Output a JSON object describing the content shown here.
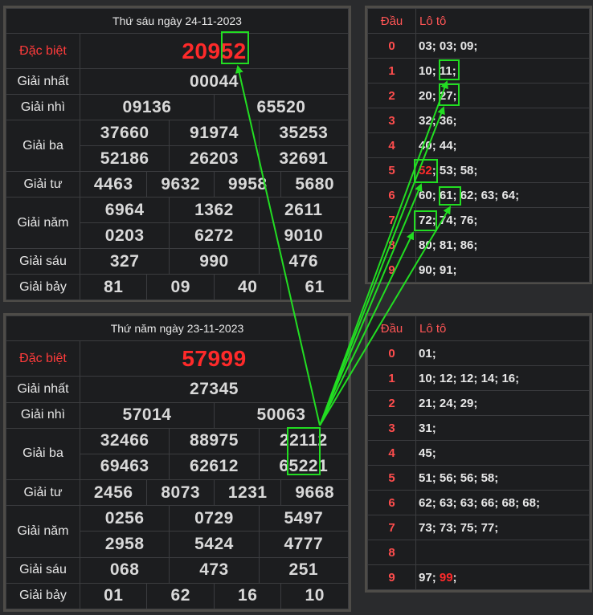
{
  "top_result": {
    "title": "Thứ sáu ngày 24-11-2023",
    "special": {
      "label": "Đặc biệt",
      "value": "20952"
    },
    "first": {
      "label": "Giải nhất",
      "value": "00044"
    },
    "second": {
      "label": "Giải nhì",
      "values": [
        "09136",
        "65520"
      ]
    },
    "third": {
      "label": "Giải ba",
      "row1": [
        "37660",
        "91974",
        "35253"
      ],
      "row2": [
        "52186",
        "26203",
        "32691"
      ]
    },
    "fourth": {
      "label": "Giải tư",
      "values": [
        "4463",
        "9632",
        "9958",
        "5680"
      ]
    },
    "fifth": {
      "label": "Giải năm",
      "row1": [
        "6964",
        "1362",
        "2611"
      ],
      "row2": [
        "0203",
        "6272",
        "9010"
      ]
    },
    "sixth": {
      "label": "Giải sáu",
      "values": [
        "327",
        "990",
        "476"
      ]
    },
    "seventh": {
      "label": "Giải bảy",
      "values": [
        "81",
        "09",
        "40",
        "61"
      ]
    }
  },
  "bottom_result": {
    "title": "Thứ năm ngày 23-11-2023",
    "special": {
      "label": "Đặc biệt",
      "value": "57999"
    },
    "first": {
      "label": "Giải nhất",
      "value": "27345"
    },
    "second": {
      "label": "Giải nhì",
      "values": [
        "57014",
        "50063"
      ]
    },
    "third": {
      "label": "Giải ba",
      "row1": [
        "32466",
        "88975",
        "22112"
      ],
      "row2": [
        "69463",
        "62612",
        "65221"
      ]
    },
    "fourth": {
      "label": "Giải tư",
      "values": [
        "2456",
        "8073",
        "1231",
        "9668"
      ]
    },
    "fifth": {
      "label": "Giải năm",
      "row1": [
        "0256",
        "0729",
        "5497"
      ],
      "row2": [
        "2958",
        "5424",
        "4777"
      ]
    },
    "sixth": {
      "label": "Giải sáu",
      "values": [
        "068",
        "473",
        "251"
      ]
    },
    "seventh": {
      "label": "Giải bảy",
      "values": [
        "01",
        "62",
        "16",
        "10"
      ]
    }
  },
  "top_loto": {
    "head_label": "Đầu",
    "loto_label": "Lô tô",
    "rows": [
      {
        "dau": "0",
        "items": [
          "03",
          "03",
          "09"
        ]
      },
      {
        "dau": "1",
        "items": [
          "10",
          "11"
        ]
      },
      {
        "dau": "2",
        "items": [
          "20",
          "27"
        ]
      },
      {
        "dau": "3",
        "items": [
          "32",
          "36"
        ]
      },
      {
        "dau": "4",
        "items": [
          "40",
          "44"
        ]
      },
      {
        "dau": "5",
        "items": [
          "52",
          "53",
          "58"
        ]
      },
      {
        "dau": "6",
        "items": [
          "60",
          "61",
          "62",
          "63",
          "64"
        ]
      },
      {
        "dau": "7",
        "items": [
          "72",
          "74",
          "76"
        ]
      },
      {
        "dau": "8",
        "items": [
          "80",
          "81",
          "86"
        ]
      },
      {
        "dau": "9",
        "items": [
          "90",
          "91"
        ]
      }
    ],
    "red_item": "52"
  },
  "bottom_loto": {
    "head_label": "Đầu",
    "loto_label": "Lô tô",
    "rows": [
      {
        "dau": "0",
        "items": [
          "01"
        ]
      },
      {
        "dau": "1",
        "items": [
          "10",
          "12",
          "12",
          "14",
          "16"
        ]
      },
      {
        "dau": "2",
        "items": [
          "21",
          "24",
          "29"
        ]
      },
      {
        "dau": "3",
        "items": [
          "31"
        ]
      },
      {
        "dau": "4",
        "items": [
          "45"
        ]
      },
      {
        "dau": "5",
        "items": [
          "51",
          "56",
          "56",
          "58"
        ]
      },
      {
        "dau": "6",
        "items": [
          "62",
          "63",
          "63",
          "66",
          "68",
          "68"
        ]
      },
      {
        "dau": "7",
        "items": [
          "73",
          "73",
          "75",
          "77"
        ]
      },
      {
        "dau": "8",
        "items": []
      },
      {
        "dau": "9",
        "items": [
          "97",
          "99"
        ]
      }
    ],
    "red_item": "99"
  },
  "colors": {
    "highlight": "#22dd22",
    "special_red": "#ff2a2a",
    "panel_bg": "#1c1d1f"
  }
}
